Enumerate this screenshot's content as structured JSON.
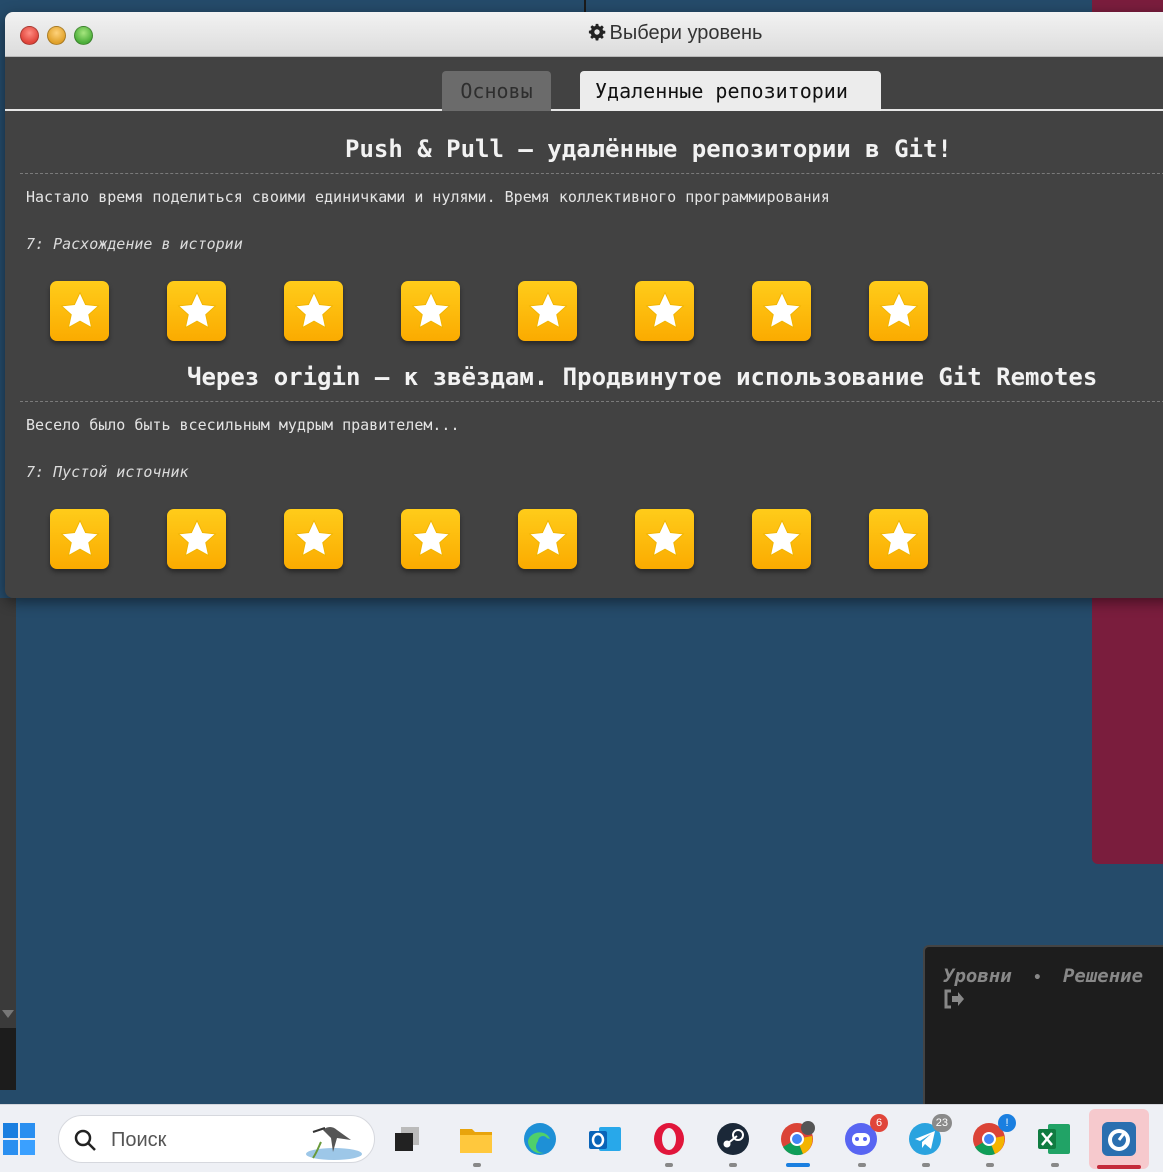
{
  "window": {
    "title": "Выбери уровень",
    "icon": "gear-icon"
  },
  "tabs": [
    {
      "label": "Основы",
      "active": false
    },
    {
      "label": "Удаленные репозитории",
      "active": true
    }
  ],
  "sections": [
    {
      "title": "Push & Pull – удалённые репозитории в Git!",
      "description": "Настало время поделиться своими единичками и нулями. Время коллективного программирования",
      "level_name": "7: Расхождение в истории",
      "stars": 8
    },
    {
      "title": "Через origin – к звёздам. Продвинутое использование Git Remotes",
      "description": "Весело было быть всесильным мудрым правителем...",
      "level_name": "7: Пустой источник",
      "stars": 8
    }
  ],
  "command_panel": {
    "levels_link": "Уровни",
    "separator": "•",
    "solution_link": "Решение",
    "exit_icon": "sign-out-icon"
  },
  "taskbar": {
    "search_placeholder": "Поиск",
    "apps": [
      {
        "name": "windows-start-icon"
      },
      {
        "name": "task-view-icon"
      },
      {
        "name": "file-explorer-icon"
      },
      {
        "name": "edge-icon"
      },
      {
        "name": "outlook-icon"
      },
      {
        "name": "opera-icon"
      },
      {
        "name": "steam-icon"
      },
      {
        "name": "chrome-icon"
      },
      {
        "name": "discord-icon",
        "badge": "6"
      },
      {
        "name": "telegram-icon",
        "badge": "23"
      },
      {
        "name": "chrome-icon",
        "badge": "!"
      },
      {
        "name": "excel-icon"
      },
      {
        "name": "app-icon"
      }
    ]
  },
  "colors": {
    "desktop": "#254b6a",
    "maroon_panel": "#7a1d3d",
    "dialog_bg": "#424242",
    "star_gold": "#fbb800",
    "active_tab": "#ececec"
  }
}
